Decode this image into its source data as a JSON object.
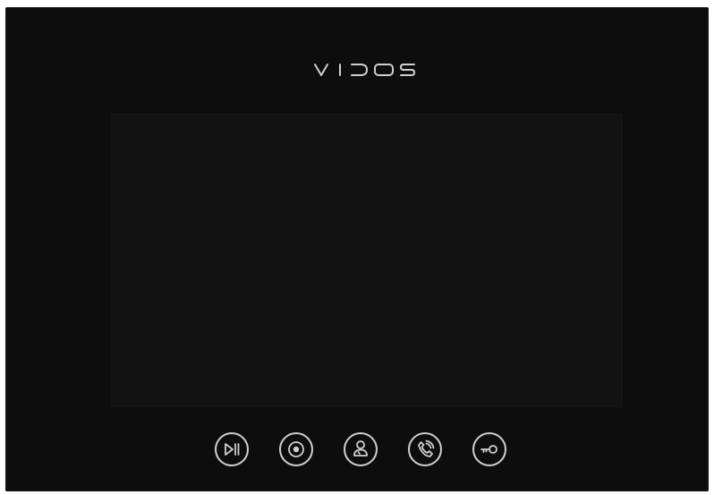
{
  "brand": {
    "logo_text": "VIDOS"
  },
  "screen": {
    "state": "off"
  },
  "buttons": [
    {
      "icon": "play-pause-icon"
    },
    {
      "icon": "record-icon"
    },
    {
      "icon": "user-icon"
    },
    {
      "icon": "phone-icon"
    },
    {
      "icon": "key-icon"
    }
  ],
  "colors": {
    "panel": "#0d0d0d",
    "screen": "#121212",
    "icon_stroke": "#cfcfcf"
  }
}
